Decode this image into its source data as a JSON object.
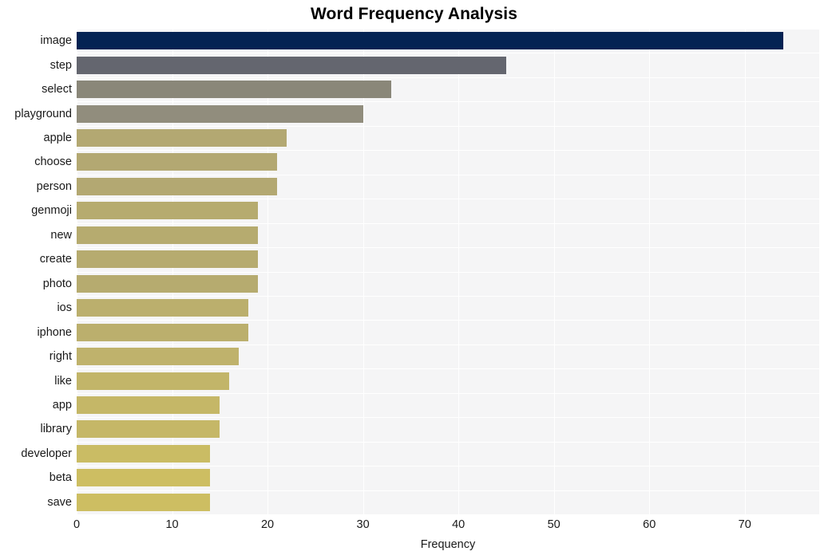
{
  "chart_data": {
    "type": "bar",
    "orientation": "horizontal",
    "title": "Word Frequency Analysis",
    "xlabel": "Frequency",
    "ylabel": "",
    "xlim": [
      0,
      77.8
    ],
    "xticks": [
      0,
      10,
      20,
      30,
      40,
      50,
      60,
      70
    ],
    "xticklabels": [
      "0",
      "10",
      "20",
      "30",
      "40",
      "50",
      "60",
      "70"
    ],
    "grid": true,
    "legend": null,
    "categories": [
      "image",
      "step",
      "select",
      "playground",
      "apple",
      "choose",
      "person",
      "genmoji",
      "new",
      "create",
      "photo",
      "ios",
      "iphone",
      "right",
      "like",
      "app",
      "library",
      "developer",
      "beta",
      "save"
    ],
    "values": [
      74,
      45,
      33,
      30,
      22,
      21,
      21,
      19,
      19,
      19,
      19,
      18,
      18,
      17,
      16,
      15,
      15,
      14,
      14,
      14
    ],
    "bar_colors": [
      "#042353",
      "#64666f",
      "#8a8779",
      "#918d7d",
      "#b3a872",
      "#b3a872",
      "#b3a872",
      "#b6ab6f",
      "#b6ab6f",
      "#b6ab6f",
      "#b6ab6f",
      "#bbaf6d",
      "#bbaf6d",
      "#bfb26c",
      "#c2b569",
      "#c5b767",
      "#c5b767",
      "#cabc64",
      "#cdbe62",
      "#cdbe62"
    ],
    "plot_background": "#f5f5f6",
    "gridline_color": "#ffffff",
    "figure_background": "#ffffff"
  }
}
